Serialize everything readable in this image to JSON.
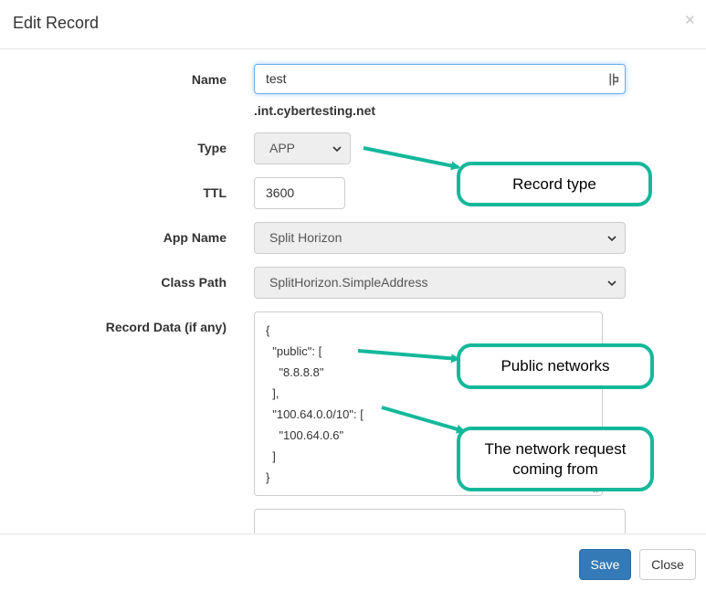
{
  "dialog": {
    "title": "Edit Record",
    "close_glyph": "×"
  },
  "form": {
    "name": {
      "label": "Name",
      "value": "test"
    },
    "domain_suffix": ".int.cybertesting.net",
    "type": {
      "label": "Type",
      "value": "APP"
    },
    "ttl": {
      "label": "TTL",
      "value": "3600"
    },
    "app_name": {
      "label": "App Name",
      "value": "Split Horizon"
    },
    "class_path": {
      "label": "Class Path",
      "value": "SplitHorizon.SimpleAddress"
    },
    "record_data": {
      "label": "Record Data (if any)",
      "lines": [
        "{",
        "  \"public\": [",
        "    \"8.8.8.8\"",
        "  ],",
        "  \"100.64.0.0/10\": [",
        "    \"100.64.0.6\"",
        "  ]",
        "}"
      ]
    }
  },
  "footer": {
    "save_label": "Save",
    "close_label": "Close"
  },
  "annotations": {
    "record_type": "Record type",
    "public_networks": "Public networks",
    "network_request": "The network request coming from",
    "color": "#15b89a"
  },
  "colors": {
    "primary": "#337ab7",
    "focus": "#66afe9",
    "select_bg": "#eeeeee"
  }
}
